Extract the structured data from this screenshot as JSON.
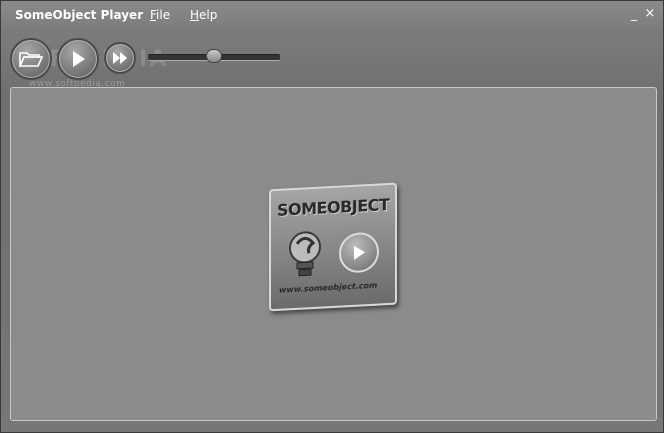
{
  "titlebar": {
    "app_title": "SomeObject Player",
    "menu": [
      {
        "label_first": "F",
        "label_rest": "ile"
      },
      {
        "label_first": "H",
        "label_rest": "elp"
      }
    ],
    "minimize_glyph": "_",
    "close_glyph": "×"
  },
  "toolbar": {
    "buttons": [
      "folder-open-icon",
      "play-icon",
      "skip-forward-icon"
    ],
    "volume_fraction": 0.5,
    "watermark": "www.softpedia.com",
    "watermark_big": "SOFTPEDIA"
  },
  "video": {
    "logo_title": "SOMEOBJECT",
    "logo_url": "www.someobject.com"
  }
}
